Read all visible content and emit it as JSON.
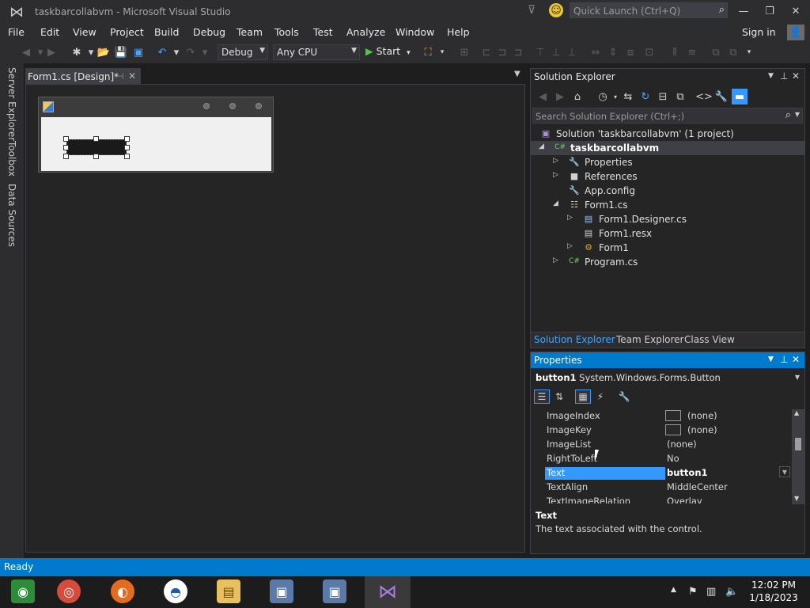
{
  "window": {
    "title": "taskbarcollabvm - Microsoft Visual Studio",
    "quick_launch_placeholder": "Quick Launch (Ctrl+Q)",
    "colors": {
      "accent": "#007acc",
      "selection": "#3399ff",
      "chrome": "#2d2d30",
      "background": "#1e1e1e"
    }
  },
  "menu": {
    "items": [
      "File",
      "Edit",
      "View",
      "Project",
      "Build",
      "Debug",
      "Team",
      "Tools",
      "Test",
      "Analyze",
      "Window",
      "Help"
    ],
    "sign_in": "Sign in"
  },
  "toolbar": {
    "configuration": "Debug",
    "platform": "Any CPU",
    "start_label": "Start"
  },
  "left_tabs": [
    "Server Explorer",
    "Toolbox",
    "Data Sources"
  ],
  "document": {
    "tab_label": "Form1.cs [Design]*"
  },
  "solution_explorer": {
    "title": "Solution Explorer",
    "search_placeholder": "Search Solution Explorer (Ctrl+;)",
    "tree": [
      {
        "label": "Solution 'taskbarcollabvm' (1 project)",
        "icon": "solution-icon"
      },
      {
        "label": "taskbarcollabvm",
        "icon": "csharp-project-icon",
        "selected": true
      },
      {
        "label": "Properties",
        "icon": "wrench-icon"
      },
      {
        "label": "References",
        "icon": "references-icon"
      },
      {
        "label": "App.config",
        "icon": "config-file-icon"
      },
      {
        "label": "Form1.cs",
        "icon": "form-file-icon"
      },
      {
        "label": "Form1.Designer.cs",
        "icon": "cs-file-icon"
      },
      {
        "label": "Form1.resx",
        "icon": "resx-file-icon"
      },
      {
        "label": "Form1",
        "icon": "class-icon"
      },
      {
        "label": "Program.cs",
        "icon": "csharp-file-icon"
      }
    ],
    "bottom_tabs": [
      "Solution Explorer",
      "Team Explorer",
      "Class View"
    ]
  },
  "properties": {
    "title": "Properties",
    "object_name": "button1",
    "object_type": "System.Windows.Forms.Button",
    "rows": [
      {
        "name": "ImageIndex",
        "value": "(none)"
      },
      {
        "name": "ImageKey",
        "value": "(none)"
      },
      {
        "name": "ImageList",
        "value": "(none)"
      },
      {
        "name": "RightToLeft",
        "value": "No"
      },
      {
        "name": "Text",
        "value": "button1"
      },
      {
        "name": "TextAlign",
        "value": "MiddleCenter"
      },
      {
        "name": "TextImageRelation",
        "value": "Overlay"
      }
    ],
    "description_name": "Text",
    "description_text": "The text associated with the control."
  },
  "status": {
    "text": "Ready"
  },
  "taskbar": {
    "apps": [
      "Windows Media Center",
      "Google Chrome",
      "Mozilla Firefox",
      "Obama 2012",
      "File Explorer",
      "Network Setup",
      "Network Setup",
      "Visual Studio"
    ],
    "time": "12:02 PM",
    "date": "1/18/2023"
  }
}
